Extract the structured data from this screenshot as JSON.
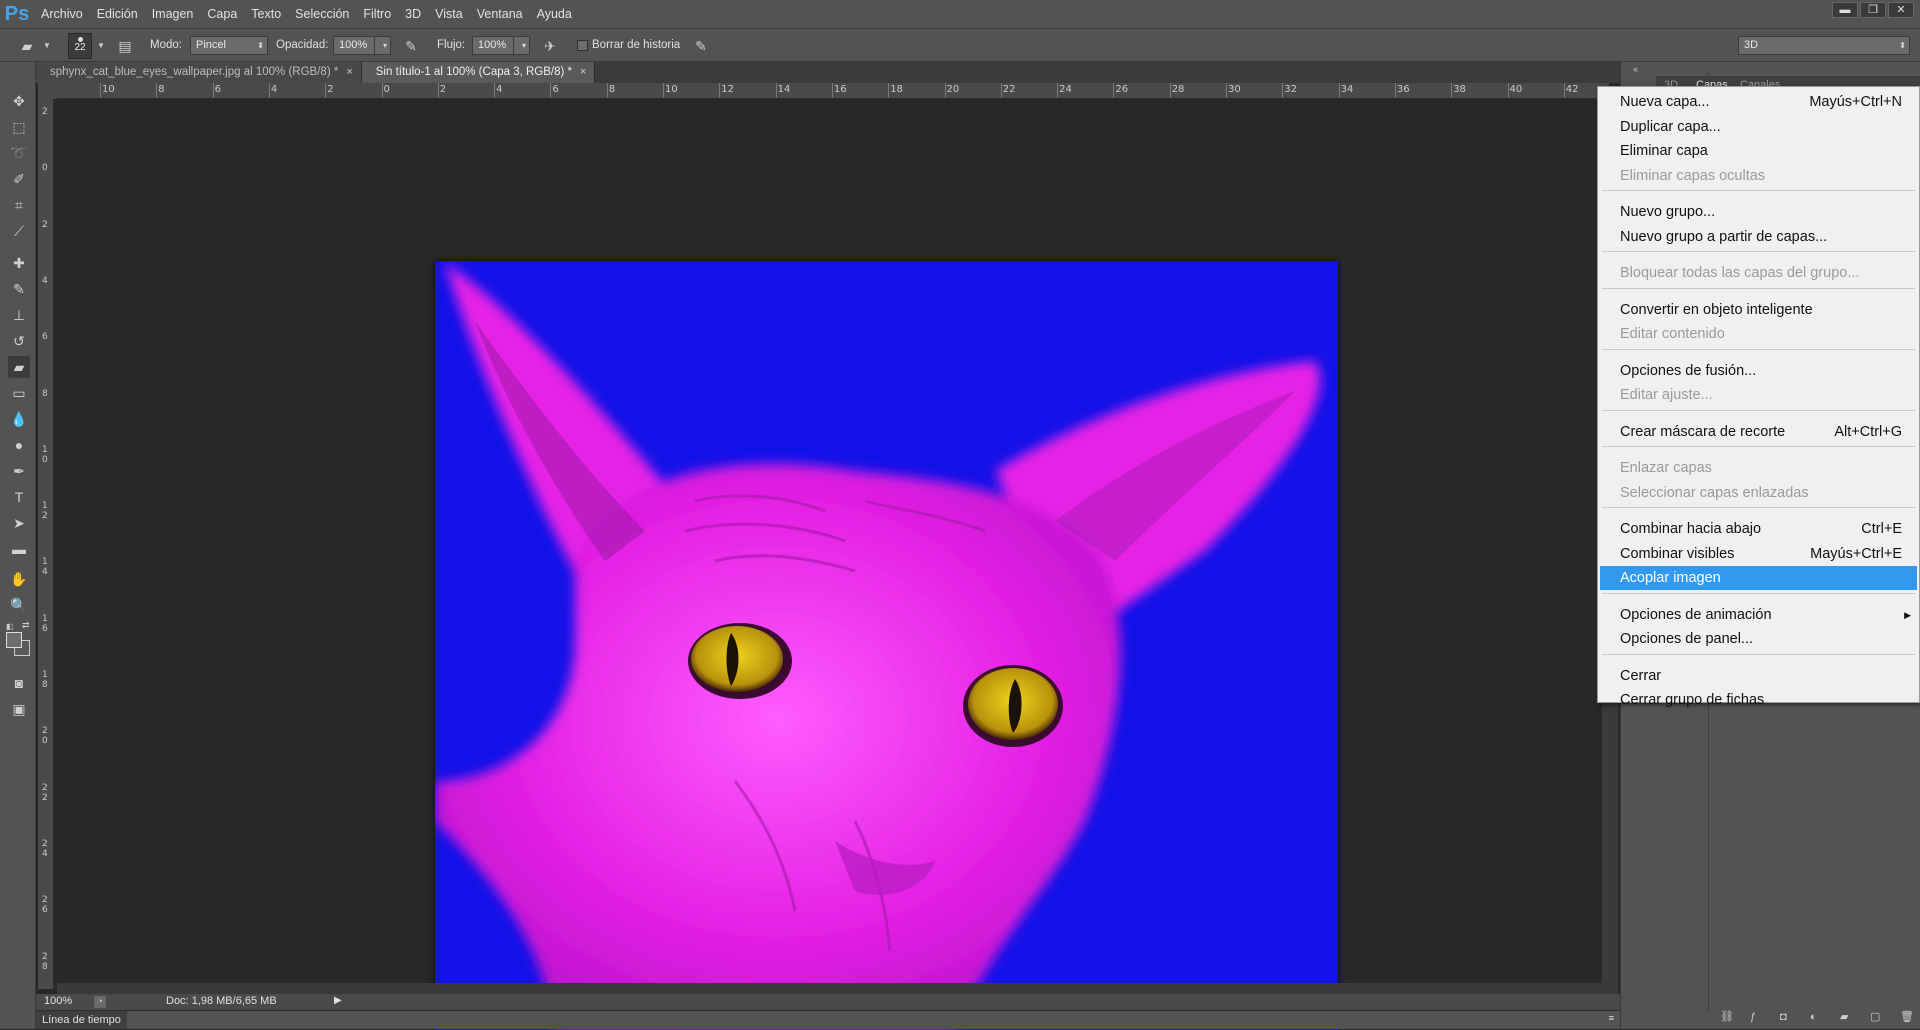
{
  "app": {
    "logo": "Ps"
  },
  "menubar": [
    "Archivo",
    "Edición",
    "Imagen",
    "Capa",
    "Texto",
    "Selección",
    "Filtro",
    "3D",
    "Vista",
    "Ventana",
    "Ayuda"
  ],
  "window_controls": {
    "minimize": "▬",
    "restore": "❐",
    "close": "✕"
  },
  "options": {
    "brush_size": "22",
    "mode_label": "Modo:",
    "mode_value": "Pincel",
    "opacity_label": "Opacidad:",
    "opacity_value": "100%",
    "flow_label": "Flujo:",
    "flow_value": "100%",
    "history_label": "Borrar de historia",
    "workspace_value": "3D"
  },
  "tabs": [
    {
      "label": "sphynx_cat_blue_eyes_wallpaper.jpg al 100% (RGB/8) *",
      "close": "×"
    },
    {
      "label": "Sin título-1 al 100% (Capa 3, RGB/8) *",
      "close": "×"
    }
  ],
  "ruler_top": [
    "10",
    "8",
    "6",
    "4",
    "2",
    "0",
    "2",
    "4",
    "6",
    "8",
    "10",
    "12",
    "14",
    "16",
    "18",
    "20",
    "22",
    "24",
    "26",
    "28",
    "30",
    "32",
    "34",
    "36",
    "38",
    "40",
    "42"
  ],
  "ruler_left": [
    "2",
    "0",
    "2",
    "4",
    "6",
    "8",
    "10",
    "12",
    "14",
    "16",
    "18",
    "20",
    "22",
    "24",
    "26",
    "28"
  ],
  "status": {
    "zoom": "100%",
    "doc": "Doc: 1,98 MB/6,65 MB"
  },
  "timeline_label": "Línea de tiempo",
  "panel_tabs": [
    "3D",
    "Capas",
    "Canales"
  ],
  "context_menu": [
    {
      "label": "Nueva capa...",
      "shortcut": "Mayús+Ctrl+N",
      "state": "enabled"
    },
    {
      "label": "Duplicar capa...",
      "shortcut": "",
      "state": "enabled"
    },
    {
      "label": "Eliminar capa",
      "shortcut": "",
      "state": "enabled"
    },
    {
      "label": "Eliminar capas ocultas",
      "shortcut": "",
      "state": "disabled"
    },
    {
      "label": "Nuevo grupo...",
      "shortcut": "",
      "state": "enabled"
    },
    {
      "label": "Nuevo grupo a partir de capas...",
      "shortcut": "",
      "state": "enabled"
    },
    {
      "label": "Bloquear todas las capas del grupo...",
      "shortcut": "",
      "state": "disabled"
    },
    {
      "label": "Convertir en objeto inteligente",
      "shortcut": "",
      "state": "enabled"
    },
    {
      "label": "Editar contenido",
      "shortcut": "",
      "state": "disabled"
    },
    {
      "label": "Opciones de fusión...",
      "shortcut": "",
      "state": "enabled"
    },
    {
      "label": "Editar ajuste...",
      "shortcut": "",
      "state": "disabled"
    },
    {
      "label": "Crear máscara de recorte",
      "shortcut": "Alt+Ctrl+G",
      "state": "enabled"
    },
    {
      "label": "Enlazar capas",
      "shortcut": "",
      "state": "disabled"
    },
    {
      "label": "Seleccionar capas enlazadas",
      "shortcut": "",
      "state": "disabled"
    },
    {
      "label": "Combinar hacia abajo",
      "shortcut": "Ctrl+E",
      "state": "enabled"
    },
    {
      "label": "Combinar visibles",
      "shortcut": "Mayús+Ctrl+E",
      "state": "enabled"
    },
    {
      "label": "Acoplar imagen",
      "shortcut": "",
      "state": "highlighted"
    },
    {
      "label": "Opciones de animación",
      "shortcut": "",
      "state": "enabled",
      "submenu": "▶"
    },
    {
      "label": "Opciones de panel...",
      "shortcut": "",
      "state": "enabled"
    },
    {
      "label": "Cerrar",
      "shortcut": "",
      "state": "enabled"
    },
    {
      "label": "Cerrar grupo de fichas",
      "shortcut": "",
      "state": "enabled"
    }
  ],
  "colors": {
    "canvas_background": "#1212e8",
    "cat": "#e020e0",
    "eyes": "#c9a413",
    "highlight": "#3399ee"
  }
}
